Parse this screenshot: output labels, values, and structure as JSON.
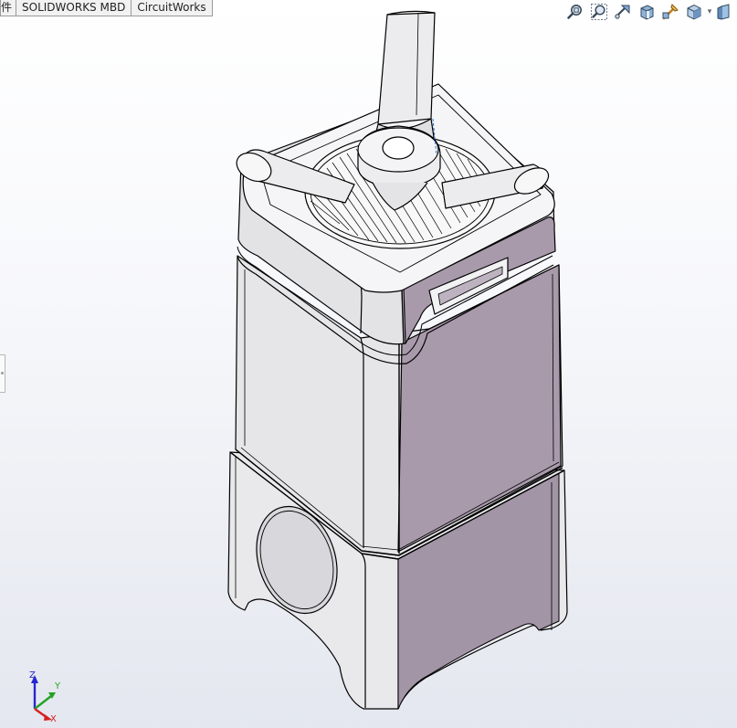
{
  "tabs": [
    {
      "label": "件"
    },
    {
      "label": "SOLIDWORKS MBD"
    },
    {
      "label": "CircuitWorks"
    }
  ],
  "headsup_toolbar": [
    {
      "icon": "zoom-to-fit-icon"
    },
    {
      "icon": "zoom-to-area-icon"
    },
    {
      "icon": "previous-view-icon"
    },
    {
      "icon": "section-view-icon"
    },
    {
      "icon": "dynamic-annotation-views-icon"
    },
    {
      "icon": "view-orientation-icon"
    },
    {
      "icon": "display-style-icon"
    }
  ],
  "triad": {
    "x_label": "X",
    "y_label": "Y",
    "z_label": "Z"
  },
  "colors": {
    "body_purple": "#a99aab",
    "body_light": "#e8e8ea",
    "edge": "#000000",
    "background_bottom": "#e4e7ef",
    "axis_x": "#d32222",
    "axis_y": "#23a323",
    "axis_z": "#2727d0"
  }
}
